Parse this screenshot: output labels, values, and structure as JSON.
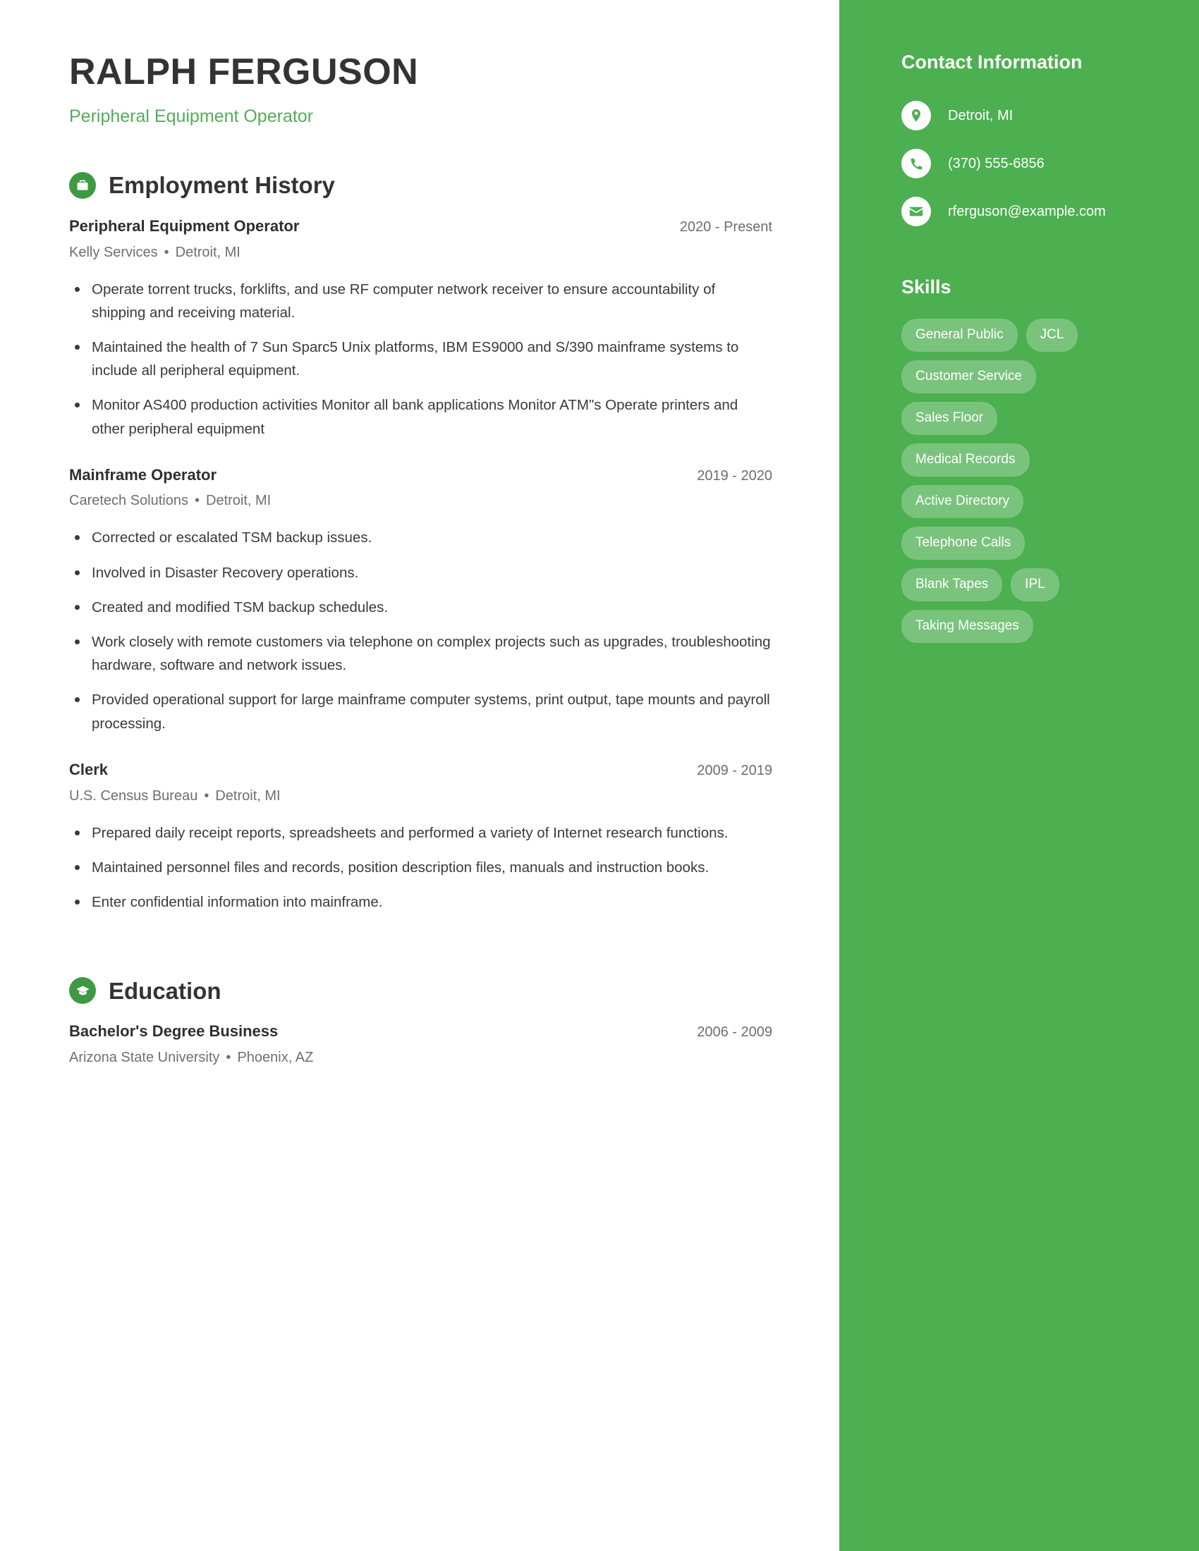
{
  "header": {
    "name": "RALPH FERGUSON",
    "title": "Peripheral Equipment Operator"
  },
  "sections": {
    "employment": {
      "heading": "Employment History",
      "icon": "briefcase-icon"
    },
    "education": {
      "heading": "Education",
      "icon": "graduation-cap-icon"
    }
  },
  "employment": [
    {
      "role": "Peripheral Equipment Operator",
      "dates": "2020 - Present",
      "company": "Kelly Services",
      "separator": "•",
      "location": "Detroit, MI",
      "bullets": [
        "Operate torrent trucks, forklifts, and use RF computer network receiver to ensure accountability of shipping and receiving material.",
        "Maintained the health of 7 Sun Sparc5 Unix platforms, IBM ES9000 and S/390 mainframe systems to include all peripheral equipment.",
        "Monitor AS400 production activities Monitor all bank applications Monitor ATM\"s Operate printers and other peripheral equipment"
      ]
    },
    {
      "role": "Mainframe Operator",
      "dates": "2019 - 2020",
      "company": "Caretech Solutions",
      "separator": "•",
      "location": "Detroit, MI",
      "bullets": [
        "Corrected or escalated TSM backup issues.",
        "Involved in Disaster Recovery operations.",
        "Created and modified TSM backup schedules.",
        "Work closely with remote customers via telephone on complex projects such as upgrades, troubleshooting hardware, software and network issues.",
        "Provided operational support for large mainframe computer systems, print output, tape mounts and payroll processing."
      ]
    },
    {
      "role": "Clerk",
      "dates": "2009 - 2019",
      "company": "U.S. Census Bureau",
      "separator": "•",
      "location": "Detroit, MI",
      "bullets": [
        "Prepared daily receipt reports, spreadsheets and performed a variety of Internet research functions.",
        "Maintained personnel files and records, position description files, manuals and instruction books.",
        "Enter confidential information into mainframe."
      ]
    }
  ],
  "education": [
    {
      "degree": "Bachelor's Degree Business",
      "dates": "2006 - 2009",
      "school": "Arizona State University",
      "separator": "•",
      "location": "Phoenix, AZ"
    }
  ],
  "sidebar": {
    "contact_heading": "Contact Information",
    "contact": [
      {
        "icon": "location-pin-icon",
        "value": "Detroit, MI"
      },
      {
        "icon": "phone-icon",
        "value": "(370) 555-6856"
      },
      {
        "icon": "envelope-icon",
        "value": "rferguson@example.com"
      }
    ],
    "skills_heading": "Skills",
    "skills": [
      "General Public",
      "JCL",
      "Customer Service",
      "Sales Floor",
      "Medical Records",
      "Active Directory",
      "Telephone Calls",
      "Blank Tapes",
      "IPL",
      "Taking Messages"
    ]
  },
  "colors": {
    "sidebar_bg": "#4caf50",
    "accent_green": "#55ab5c",
    "icon_circle": "#3d9a42",
    "heading_dark": "#333333",
    "body_text": "#3a3a3a",
    "muted_text": "#6f6f6f"
  }
}
